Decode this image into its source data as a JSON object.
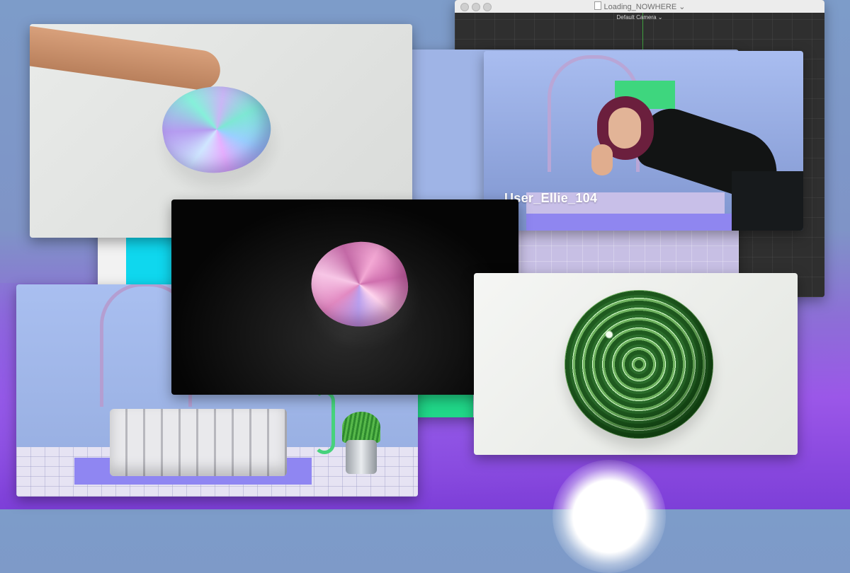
{
  "desktop": {
    "background": "purple-blue gradient"
  },
  "app_window": {
    "title": "Loading_NOWHERE",
    "title_chevron": "⌄",
    "viewport_label": "Default Camera",
    "viewport_label_suffix": "⌄"
  },
  "video_window": {
    "username": "User_Ellie_104"
  },
  "colors": {
    "accent_green": "#20d788",
    "accent_cyan": "#0fd7ee",
    "pad_purple": "#8f86f0"
  }
}
